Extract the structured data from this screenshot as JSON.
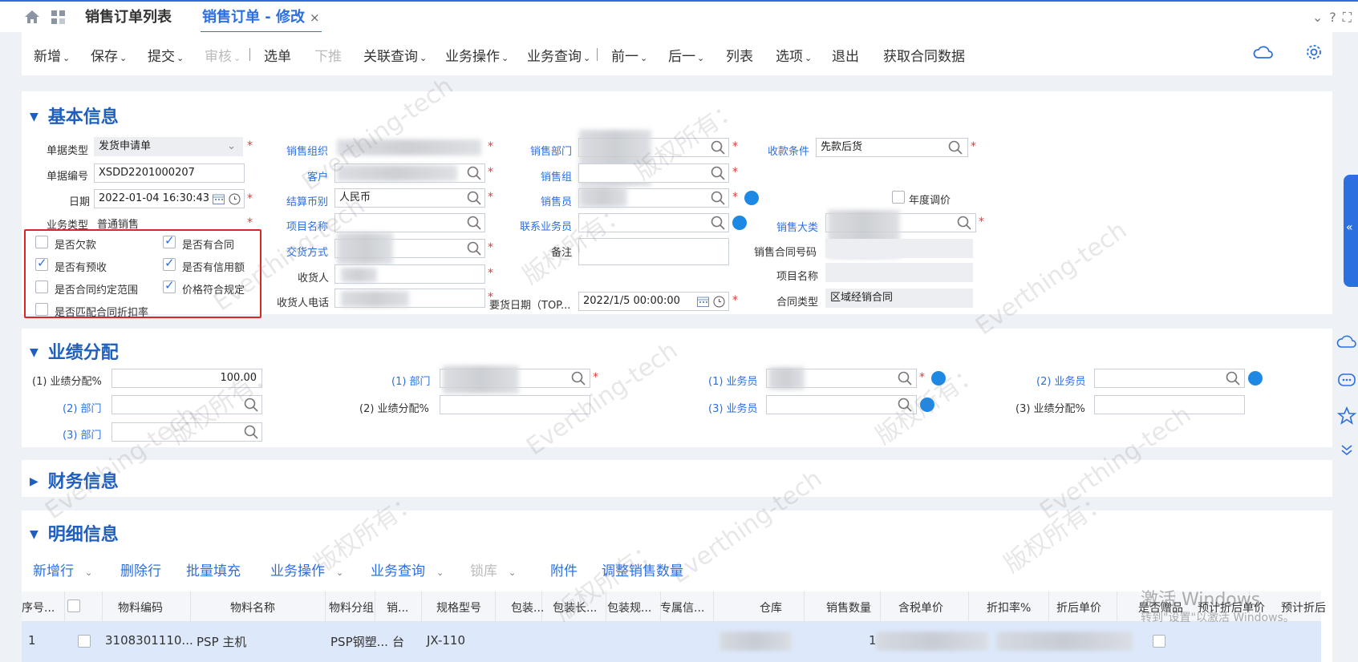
{
  "tabs": {
    "list_tab": "销售订单列表",
    "edit_tab": "销售订单 - 修改",
    "close_symbol": "×"
  },
  "toolbar": [
    {
      "label": "新增",
      "dropdown": true,
      "enabled": true
    },
    {
      "label": "保存",
      "dropdown": true,
      "enabled": true
    },
    {
      "label": "提交",
      "dropdown": true,
      "enabled": true
    },
    {
      "label": "审核",
      "dropdown": true,
      "enabled": false
    },
    {
      "label": "选单",
      "dropdown": false,
      "enabled": true
    },
    {
      "label": "下推",
      "dropdown": false,
      "enabled": false
    },
    {
      "label": "关联查询",
      "dropdown": true,
      "enabled": true
    },
    {
      "label": "业务操作",
      "dropdown": true,
      "enabled": true
    },
    {
      "label": "业务查询",
      "dropdown": true,
      "enabled": true
    },
    {
      "label": "前一",
      "dropdown": true,
      "enabled": true
    },
    {
      "label": "后一",
      "dropdown": true,
      "enabled": true
    },
    {
      "label": "列表",
      "dropdown": false,
      "enabled": true
    },
    {
      "label": "选项",
      "dropdown": true,
      "enabled": true
    },
    {
      "label": "退出",
      "dropdown": false,
      "enabled": true
    },
    {
      "label": "获取合同数据",
      "dropdown": false,
      "enabled": true
    }
  ],
  "sections": {
    "basic": "基本信息",
    "performance": "业绩分配",
    "finance": "财务信息",
    "detail": "明细信息"
  },
  "basic": {
    "doc_type_label": "单据类型",
    "doc_type_value": "发货申请单",
    "doc_no_label": "单据编号",
    "doc_no_value": "XSDD2201000207",
    "date_label": "日期",
    "date_value": "2022-01-04 16:30:43",
    "biz_type_label": "业务类型",
    "biz_type_value": "普通销售",
    "sales_org_label": "销售组织",
    "customer_label": "客户",
    "currency_label": "结算币别",
    "currency_value": "人民币",
    "project_label": "项目名称",
    "trade_method_label": "交货方式",
    "receiver_label": "收货人",
    "receiver_phone_label": "收货人电话",
    "sales_dept_label": "销售部门",
    "sales_group_label": "销售组",
    "salesman_label": "销售员",
    "contact_salesman_label": "联系业务员",
    "remark_label": "备注",
    "delivery_date_label": "要货日期（TOP...",
    "delivery_date_value": "2022/1/5 00:00:00",
    "payment_terms_label": "收款条件",
    "payment_terms_value": "先款后货",
    "annual_adjust_label": "年度调价",
    "sales_category_label": "销售大类",
    "contract_no_label": "销售合同号码",
    "project_name2_label": "项目名称",
    "contract_type_label": "合同类型",
    "contract_type_value": "区域经销合同"
  },
  "checkboxes": [
    {
      "label": "是否欠款",
      "checked": false
    },
    {
      "label": "是否有合同",
      "checked": true
    },
    {
      "label": "是否有预收",
      "checked": true
    },
    {
      "label": "是否有信用额",
      "checked": true
    },
    {
      "label": "是否合同约定范围",
      "checked": false
    },
    {
      "label": "价格符合规定",
      "checked": true
    },
    {
      "label": "是否匹配合同折扣率",
      "checked": false
    }
  ],
  "performance": {
    "ratio1_label": "(1) 业绩分配%",
    "ratio1_value": "100.00",
    "dept2_label": "(2) 部门",
    "dept3_label": "(3) 部门",
    "dept1_label": "(1) 部门",
    "ratio2_label": "(2) 业绩分配%",
    "salesman1_label": "(1) 业务员",
    "salesman3_label": "(3) 业务员",
    "salesman2_label": "(2) 业务员",
    "ratio3_label": "(3) 业绩分配%"
  },
  "detail_toolbar": [
    {
      "label": "新增行",
      "dropdown": true,
      "enabled": true
    },
    {
      "label": "删除行",
      "dropdown": false,
      "enabled": true
    },
    {
      "label": "批量填充",
      "dropdown": false,
      "enabled": true
    },
    {
      "label": "业务操作",
      "dropdown": true,
      "enabled": true
    },
    {
      "label": "业务查询",
      "dropdown": true,
      "enabled": true
    },
    {
      "label": "锁库",
      "dropdown": true,
      "enabled": false
    },
    {
      "label": "附件",
      "dropdown": false,
      "enabled": true
    },
    {
      "label": "调整销售数量",
      "dropdown": false,
      "enabled": true
    }
  ],
  "grid": {
    "headers": [
      "序号...",
      "物料编码",
      "物料名称",
      "物料分组",
      "销...",
      "规格型号",
      "包装...",
      "包装长...",
      "包装规...",
      "专属信...",
      "仓库",
      "销售数量",
      "含税单价",
      "折扣率%",
      "折后单价",
      "是否赠品",
      "预计折后单价",
      "预计折后"
    ],
    "row": [
      "1",
      "3108301110...",
      "PSP 主机",
      "PSP钢塑...",
      "台",
      "JX-110",
      "1"
    ]
  },
  "watermarks": [
    "Everthing-tech",
    "版权所有："
  ],
  "windows_activation": {
    "line1": "激活 Windows",
    "line2": "转到\"设置\"以激活 Windows。"
  },
  "colors": {
    "accent": "#2c6fe0",
    "required": "#e53935",
    "highlight_box": "#e02424"
  }
}
